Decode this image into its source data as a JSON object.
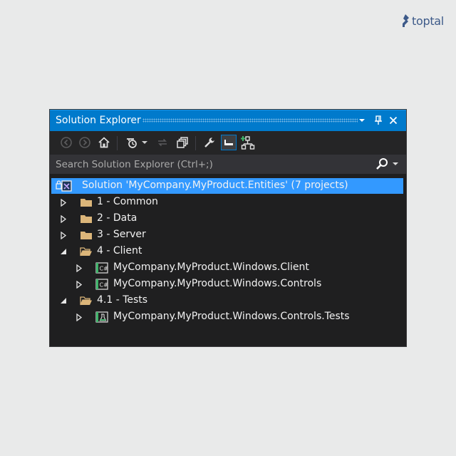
{
  "logo": {
    "text": "toptal",
    "color": "#3d5a89"
  },
  "window": {
    "title": "Solution Explorer",
    "title_buttons": [
      "dropdown-icon",
      "pin-icon",
      "close-icon"
    ]
  },
  "toolbar": {
    "buttons": [
      "back-icon",
      "forward-icon",
      "home-icon",
      "history-icon",
      "sync-icon",
      "collapse-all-icon",
      "properties-icon",
      "preview-icon",
      "view-switch-icon"
    ],
    "active_button": "preview-icon"
  },
  "search": {
    "placeholder": "Search Solution Explorer (Ctrl+;)"
  },
  "tree": {
    "items": [
      {
        "label": "Solution 'MyCompany.MyProduct.Entities' (7 projects)",
        "icon": "solution-icon",
        "selected": true
      },
      {
        "label": "1 - Common",
        "icon": "folder-icon",
        "expander": "collapsed"
      },
      {
        "label": "2 - Data",
        "icon": "folder-icon",
        "expander": "collapsed"
      },
      {
        "label": "3 - Server",
        "icon": "folder-icon",
        "expander": "collapsed"
      },
      {
        "label": "4 - Client",
        "icon": "folder-open-icon",
        "expander": "expanded"
      },
      {
        "label": "MyCompany.MyProduct.Windows.Client",
        "icon": "csharp-project-icon",
        "expander": "collapsed"
      },
      {
        "label": "MyCompany.MyProduct.Windows.Controls",
        "icon": "csharp-project-icon",
        "expander": "collapsed"
      },
      {
        "label": "4.1 - Tests",
        "icon": "folder-open-icon",
        "expander": "expanded"
      },
      {
        "label": "MyCompany.MyProduct.Windows.Controls.Tests",
        "icon": "test-project-icon",
        "expander": "collapsed"
      }
    ]
  },
  "colors": {
    "accent": "#007acc",
    "selection": "#3399ff",
    "panel_background": "#1f1f20",
    "folder": "#dcb67a",
    "csharp": "#3fb46a"
  }
}
